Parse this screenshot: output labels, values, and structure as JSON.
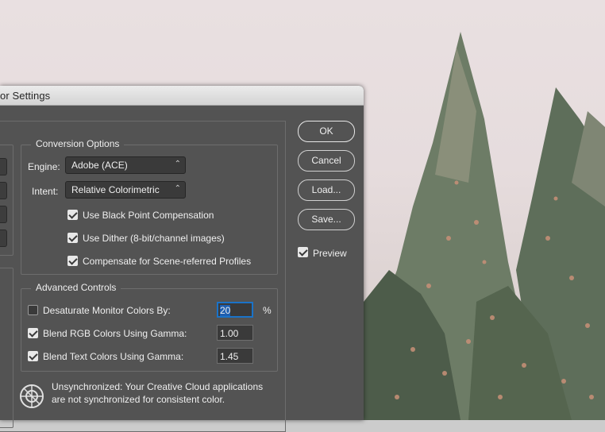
{
  "dialog": {
    "title": "or Settings",
    "conversion": {
      "title": "Conversion Options",
      "engine_label": "Engine:",
      "engine_value": "Adobe (ACE)",
      "intent_label": "Intent:",
      "intent_value": "Relative Colorimetric",
      "options": [
        {
          "label": "Use Black Point Compensation",
          "checked": true
        },
        {
          "label": "Use Dither (8-bit/channel images)",
          "checked": true
        },
        {
          "label": "Compensate for Scene-referred Profiles",
          "checked": true
        }
      ]
    },
    "advanced": {
      "title": "Advanced Controls",
      "desaturate": {
        "label": "Desaturate Monitor Colors By:",
        "checked": false,
        "value": "20",
        "unit": "%"
      },
      "blend_rgb": {
        "label": "Blend RGB Colors Using Gamma:",
        "checked": true,
        "value": "1.00"
      },
      "blend_text": {
        "label": "Blend Text Colors Using Gamma:",
        "checked": true,
        "value": "1.45"
      }
    },
    "message": {
      "line1": "Unsynchronized: Your Creative Cloud applications",
      "line2": "are not synchronized for consistent color."
    },
    "buttons": {
      "ok": "OK",
      "cancel": "Cancel",
      "load": "Load...",
      "save": "Save..."
    },
    "preview": {
      "label": "Preview",
      "checked": true
    }
  },
  "icons": {
    "chevron": "chevron-updown-icon",
    "sync": "color-sync-icon",
    "check": "checkmark-icon"
  }
}
